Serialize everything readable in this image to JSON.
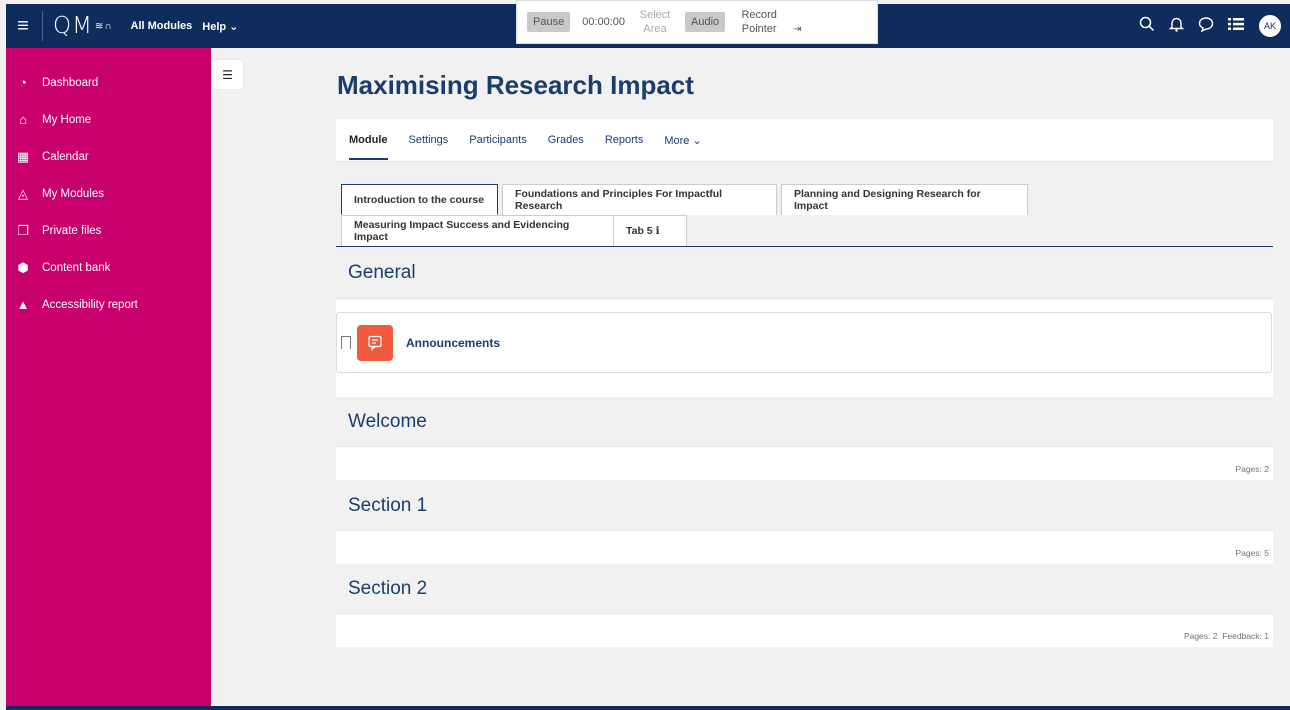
{
  "header": {
    "logo_text": "QM",
    "logo_mark": "≋∩",
    "links": [
      "All Modules",
      "Help ⌄"
    ],
    "recorder": {
      "pause": "Pause",
      "timer": "00:00:00",
      "select_area": "Select Area",
      "audio": "Audio",
      "record_pointer": "Record Pointer",
      "pin_icon": "⇥"
    },
    "avatar_initials": "AK"
  },
  "sidebar": {
    "items": [
      {
        "label": "Dashboard",
        "icon": "◔"
      },
      {
        "label": "My Home",
        "icon": "⌂"
      },
      {
        "label": "Calendar",
        "icon": "▦"
      },
      {
        "label": "My Modules",
        "icon": "◬"
      },
      {
        "label": "Private files",
        "icon": "❐"
      },
      {
        "label": "Content bank",
        "icon": "⬢"
      },
      {
        "label": "Accessibility report",
        "icon": "▲"
      }
    ]
  },
  "page": {
    "title": "Maximising Research Impact"
  },
  "secondary_nav": {
    "items": [
      "Module",
      "Settings",
      "Participants",
      "Grades",
      "Reports",
      "More ⌄"
    ]
  },
  "tabs": {
    "row1": [
      "Introduction to the course",
      "Foundations and Principles For Impactful Research",
      "Planning and Designing Research for Impact"
    ],
    "row2": [
      "Measuring Impact Success and Evidencing Impact",
      "Tab 5 ℹ"
    ]
  },
  "sections": {
    "general": "General",
    "announcements": "Announcements",
    "welcome": "Welcome",
    "welcome_pages": "Pages: 2",
    "section1": "Section 1",
    "section1_pages": "Pages: 5",
    "section2": "Section 2",
    "section2_pages": "Pages: 2  Feedback: 1"
  },
  "colors": {
    "navbar": "#0f2d5c",
    "sidebar": "#c8006d",
    "accent": "#1b3d6e",
    "activity_icon": "#f05a3e"
  }
}
